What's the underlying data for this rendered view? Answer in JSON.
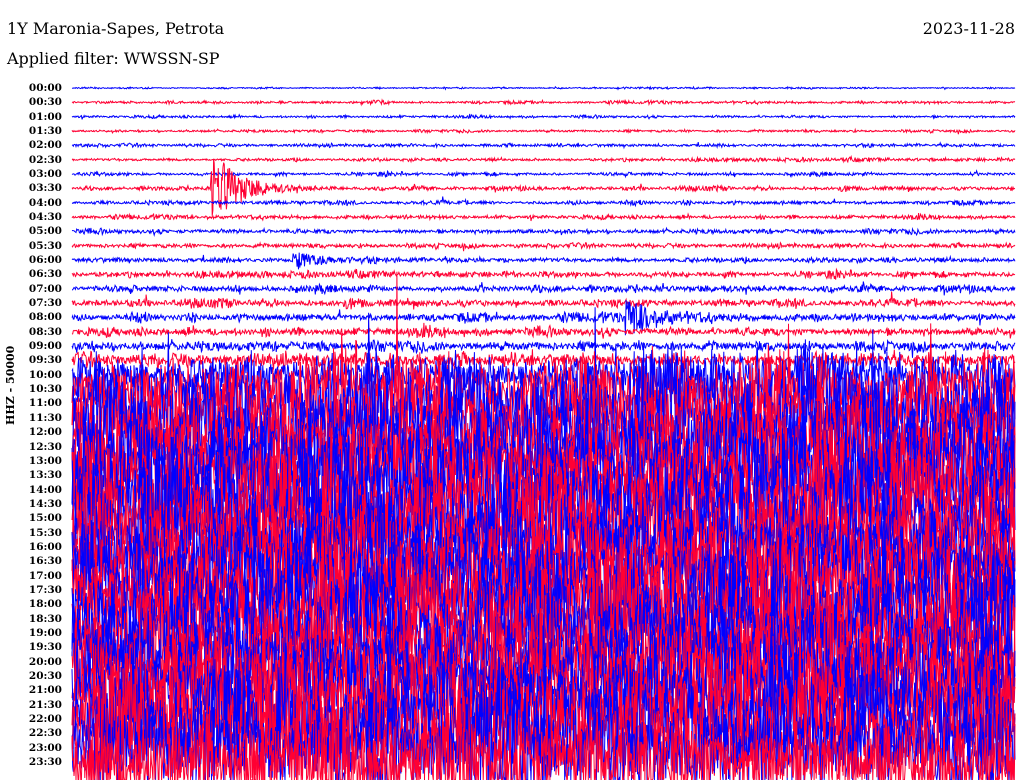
{
  "header": {
    "station": "1Y Maronia-Sapes, Petrota",
    "date": "2023-11-28",
    "filter": "Applied filter: WWSSN-SP"
  },
  "chart_data": {
    "type": "helicorder",
    "title": "1Y Maronia-Sapes, Petrota",
    "ylabel": "HHZ - 50000",
    "minutes_per_line": 30,
    "colors": [
      "#0000ff",
      "#ff0033"
    ],
    "y_ticks": [
      "00:00",
      "00:30",
      "01:00",
      "01:30",
      "02:00",
      "02:30",
      "03:00",
      "03:30",
      "04:00",
      "04:30",
      "05:00",
      "05:30",
      "06:00",
      "06:30",
      "07:00",
      "07:30",
      "08:00",
      "08:30",
      "09:00",
      "09:30",
      "10:00",
      "10:30",
      "11:00",
      "11:30",
      "12:00",
      "12:30",
      "13:00",
      "13:30",
      "14:00",
      "14:30",
      "15:00",
      "15:30",
      "16:00",
      "16:30",
      "17:00",
      "17:30",
      "18:00",
      "18:30",
      "19:00",
      "19:30",
      "20:00",
      "20:30",
      "21:00",
      "21:30",
      "22:00",
      "22:30",
      "23:00",
      "23:30"
    ],
    "relative_noise_amplitude": [
      0.05,
      0.08,
      0.08,
      0.08,
      0.1,
      0.1,
      0.1,
      0.12,
      0.12,
      0.12,
      0.14,
      0.14,
      0.16,
      0.18,
      0.2,
      0.22,
      0.24,
      0.26,
      0.3,
      0.45,
      1.2,
      2.0,
      2.5,
      2.8,
      3.0,
      3.0,
      3.0,
      3.0,
      3.0,
      3.0,
      3.0,
      3.0,
      3.0,
      3.0,
      3.0,
      3.0,
      3.0,
      3.0,
      3.0,
      3.0,
      3.0,
      3.0,
      3.0,
      3.0,
      3.0,
      3.0,
      3.0,
      3.0
    ],
    "events": [
      {
        "line": "03:30",
        "minute": 4.5,
        "relative_amplitude": 2.5
      },
      {
        "line": "06:00",
        "minute": 7.1,
        "relative_amplitude": 0.6
      },
      {
        "line": "08:00",
        "minute": 17.7,
        "relative_amplitude": 1.3
      }
    ]
  }
}
